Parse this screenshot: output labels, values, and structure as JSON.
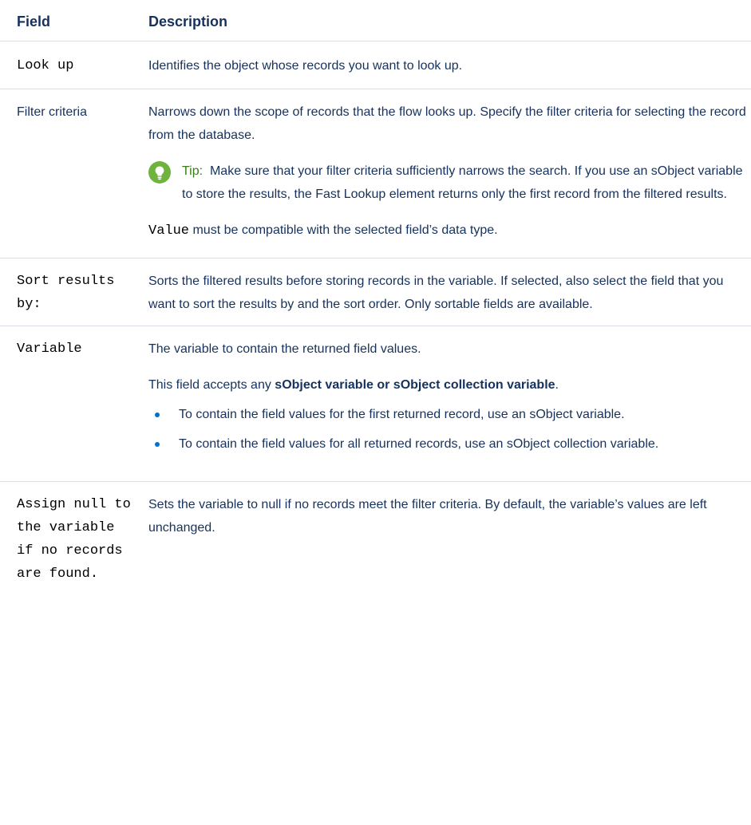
{
  "table": {
    "headers": {
      "field": "Field",
      "description": "Description"
    },
    "rows": [
      {
        "field": "Look up",
        "description": "Identifies the object whose records you want to look up."
      },
      {
        "field": "Filter criteria",
        "description": "Narrows down the scope of records that the flow looks up. Specify the filter criteria for selecting the record from the database.",
        "tip_label": "Tip:",
        "tip_text": "Make sure that your filter criteria sufficiently narrows the search. If you use an sObject variable to store the results, the Fast Lookup element returns only the first record from the filtered results.",
        "value_code": "Value",
        "value_text": " must be compatible with the selected field’s data type."
      },
      {
        "field": "Sort results by:",
        "description": "Sorts the filtered results before storing records in the variable. If selected, also select the field that you want to sort the results by and the sort order. Only sortable fields are available."
      },
      {
        "field": "Variable",
        "description": "The variable to contain the returned field values.",
        "accepts_prefix": "This field accepts any ",
        "accepts_bold": "sObject variable or sObject collection variable",
        "accepts_suffix": ".",
        "bullets": [
          "To contain the field values for the first returned record, use an sObject variable.",
          "To contain the field values for all returned records, use an sObject collection variable."
        ]
      },
      {
        "field": "Assign null to the variable if no records are found.",
        "description": "Sets the variable to null if no records meet the filter criteria. By default, the variable’s values are left unchanged."
      }
    ]
  },
  "icons": {
    "tip": "lightbulb-icon",
    "bullet": "bullet-dot-icon"
  },
  "colors": {
    "text": "#16325c",
    "tip_icon": "#6fb33f",
    "tip_label": "#3a7d1a",
    "bullet": "#0070d2",
    "divider": "#d8dde6"
  }
}
